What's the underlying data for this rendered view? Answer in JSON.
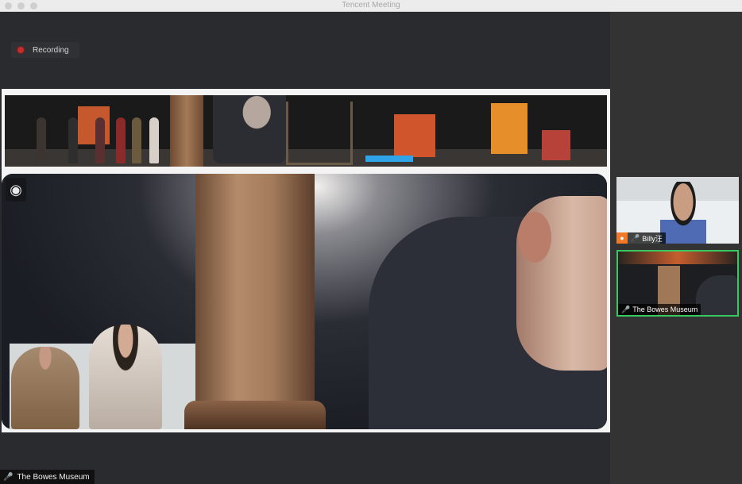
{
  "window": {
    "title": "Tencent Meeting"
  },
  "recording": {
    "label": "Recording",
    "color": "#c92b2b"
  },
  "active_speaker": {
    "name": "The Bowes Museum",
    "mic_icon": "mic-icon"
  },
  "participants": [
    {
      "name": "Billy汪",
      "avatar_icon": "person-icon",
      "mic_icon": "mic-icon"
    },
    {
      "name": "The Bowes Museum",
      "mic_icon": "mic-icon",
      "highlight_color": "#37c95f"
    }
  ],
  "share_logo": {
    "icon": "owl-logo-icon"
  }
}
